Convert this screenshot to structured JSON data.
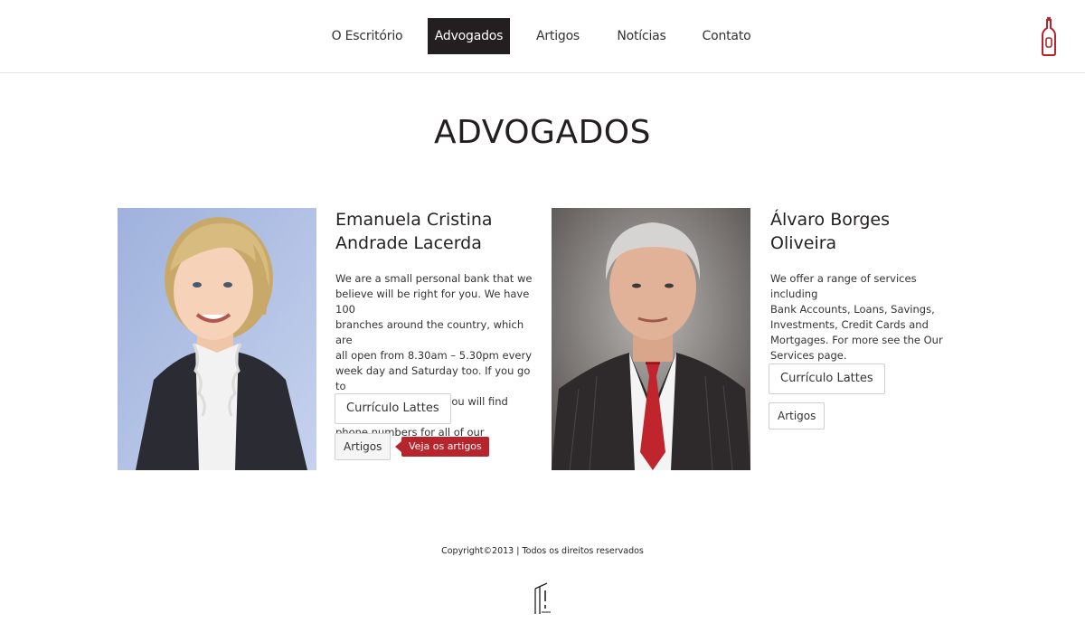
{
  "nav": {
    "items": [
      {
        "label": "O Escritório"
      },
      {
        "label": "Advogados",
        "active": true
      },
      {
        "label": "Artigos"
      },
      {
        "label": "Notícias"
      },
      {
        "label": "Contato"
      }
    ],
    "logo_icon": "wine-bottle-icon"
  },
  "page": {
    "title": "ADVOGADOS"
  },
  "lawyers": [
    {
      "name_line1": "Emanuela Cristina",
      "name_line2": "Andrade Lacerda",
      "desc_lines": [
        "We are a small personal bank that we",
        "believe will be right for you. We have 100",
        "branches around the country, which are",
        "all open from 8.30am – 5.30pm every",
        "week day and Saturday too. If you go to",
        "our Contact Us page you will find contact",
        "phone numbers for all of our branches."
      ],
      "lattes_label": "Currículo Lattes",
      "artigos_label": "Artigos",
      "tooltip": "Veja os artigos"
    },
    {
      "name_line1": "Álvaro Borges",
      "name_line2": "Oliveira",
      "desc_lines": [
        "We offer a range of services including",
        "Bank Accounts, Loans, Savings,",
        "Investments, Credit Cards and",
        "Mortgages. For more see the Our",
        "Services page."
      ],
      "lattes_label": "Currículo Lattes",
      "artigos_label": "Artigos"
    }
  ],
  "footer": {
    "copyright": "Copyright©2013 | Todos os direitos reservados"
  },
  "colors": {
    "accent": "#b8242c",
    "dark": "#231f20",
    "border": "#e2e2e2"
  }
}
